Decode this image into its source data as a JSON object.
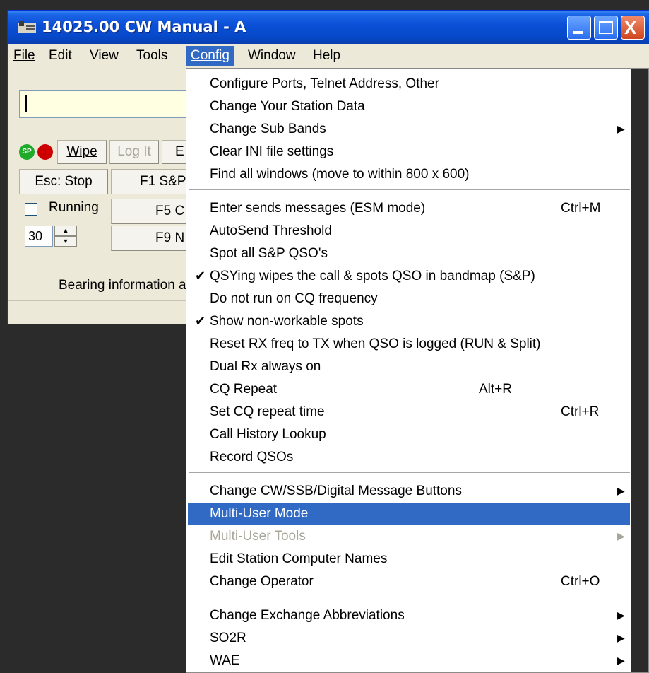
{
  "window": {
    "title": "14025.00 CW Manual - A",
    "close_glyph": "X"
  },
  "menubar": {
    "items": [
      "File",
      "Edit",
      "View",
      "Tools",
      "Config",
      "Window",
      "Help"
    ],
    "active": "Config"
  },
  "entry_window": {
    "value": ""
  },
  "indicators": {
    "sp_label": "SP"
  },
  "buttons": {
    "wipe": "Wipe",
    "log_it": "Log It",
    "e_partial": "E",
    "esc_stop": "Esc: Stop",
    "f1_partial": "F1 S&P",
    "f5_partial": "F5 C",
    "f9_partial": "F9 N"
  },
  "running": {
    "label": "Running",
    "checked": false
  },
  "repeat_spinner": {
    "value": "30"
  },
  "bearing_text": "Bearing information a",
  "config_menu": {
    "groups": [
      [
        {
          "label": "Configure Ports, Telnet Address, Other"
        },
        {
          "label": "Change Your Station Data"
        },
        {
          "label": "Change Sub Bands",
          "submenu": true
        },
        {
          "label": "Clear INI file settings"
        },
        {
          "label": "Find all windows (move to within 800 x 600)"
        }
      ],
      [
        {
          "label": "Enter sends messages (ESM mode)",
          "shortcut": "Ctrl+M"
        },
        {
          "label": "AutoSend Threshold"
        },
        {
          "label": "Spot all S&P QSO's"
        },
        {
          "label": "QSYing wipes the call & spots QSO in bandmap (S&P)",
          "checked": true
        },
        {
          "label": "Do not run on CQ frequency"
        },
        {
          "label": "Show non-workable spots",
          "checked": true
        },
        {
          "label": "Reset RX freq to TX when QSO is logged (RUN & Split)"
        },
        {
          "label": "Dual Rx always on"
        },
        {
          "label": "CQ Repeat",
          "shortcut": "Alt+R",
          "shortcut_col": "mid"
        },
        {
          "label": "Set CQ repeat time",
          "shortcut": "Ctrl+R"
        },
        {
          "label": "Call History Lookup"
        },
        {
          "label": "Record QSOs"
        }
      ],
      [
        {
          "label": "Change CW/SSB/Digital Message Buttons",
          "submenu": true
        },
        {
          "label": "Multi-User Mode",
          "highlighted": true
        },
        {
          "label": "Multi-User Tools",
          "submenu": true,
          "disabled": true
        },
        {
          "label": "Edit Station Computer Names"
        },
        {
          "label": "Change Operator",
          "shortcut": "Ctrl+O"
        }
      ],
      [
        {
          "label": "Change Exchange Abbreviations",
          "submenu": true
        },
        {
          "label": "SO2R",
          "submenu": true
        },
        {
          "label": "WAE",
          "submenu": true
        }
      ]
    ]
  },
  "glyphs": {
    "check": "✔",
    "submenu_arrow": "▶",
    "spin_up": "▲",
    "spin_down": "▼"
  },
  "colors": {
    "titlebar": "#0a4fd6",
    "menu_highlight": "#316ac5",
    "entry_bg": "#ffffe1",
    "disabled_text": "#a8a699"
  }
}
